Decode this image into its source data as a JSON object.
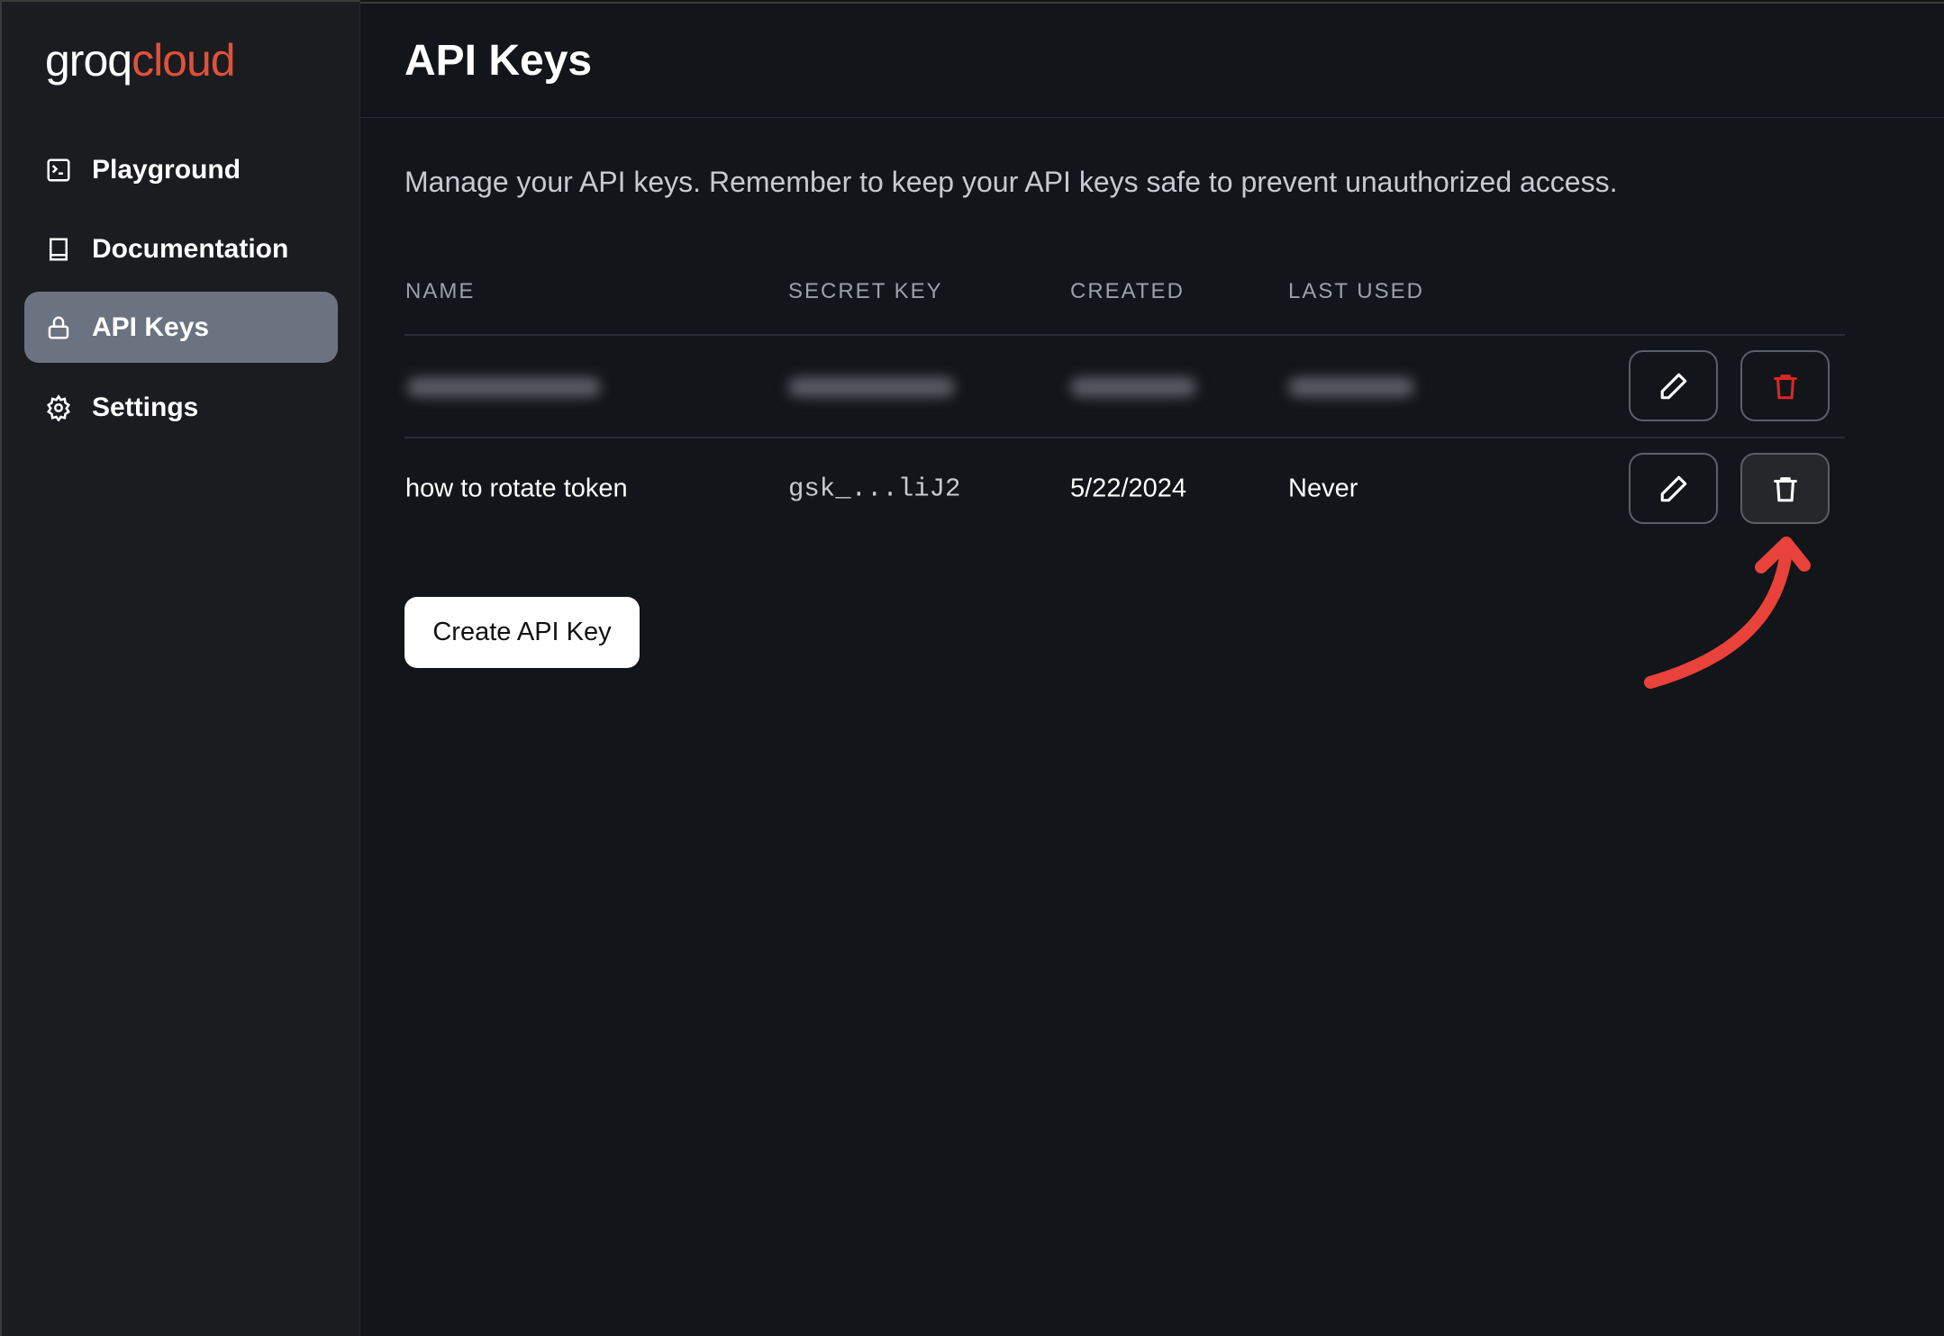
{
  "logo": {
    "part1": "groq",
    "part2": "cloud"
  },
  "sidebar": {
    "items": [
      {
        "label": "Playground",
        "icon": "terminal-icon"
      },
      {
        "label": "Documentation",
        "icon": "book-icon"
      },
      {
        "label": "API Keys",
        "icon": "lock-icon",
        "active": true
      },
      {
        "label": "Settings",
        "icon": "gear-icon"
      }
    ]
  },
  "header": {
    "title": "API Keys"
  },
  "description": "Manage your API keys. Remember to keep your API keys safe to prevent unauthorized access.",
  "table": {
    "columns": [
      "NAME",
      "SECRET KEY",
      "CREATED",
      "LAST USED"
    ],
    "rows": [
      {
        "blurred": true
      },
      {
        "name": "how to rotate token",
        "secret_key": "gsk_...liJ2",
        "created": "5/22/2024",
        "last_used": "Never"
      }
    ]
  },
  "create_button": "Create API Key",
  "colors": {
    "accent": "#e0513a",
    "delete_red": "#dc2626",
    "annotation": "#e8423a",
    "active_nav": "#6b7280"
  }
}
